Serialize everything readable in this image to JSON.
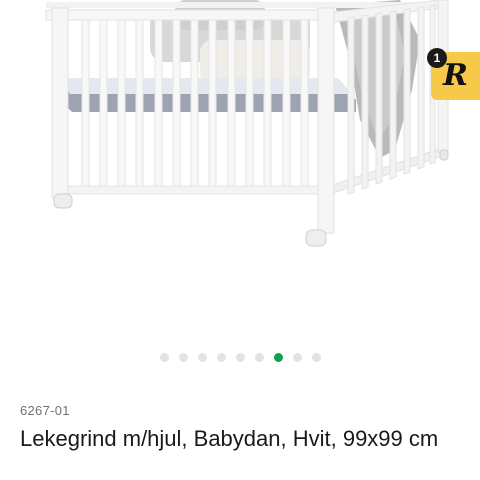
{
  "badge": {
    "count": "1",
    "letter": "R"
  },
  "carousel": {
    "total": 9,
    "active_index": 6
  },
  "product": {
    "sku": "6267-01",
    "title": "Lekegrind m/hjul, Babydan, Hvit, 99x99 cm"
  },
  "colors": {
    "active_dot": "#12a14b",
    "inactive_dot": "#e3e3e3",
    "badge_bg": "#f7c948"
  }
}
